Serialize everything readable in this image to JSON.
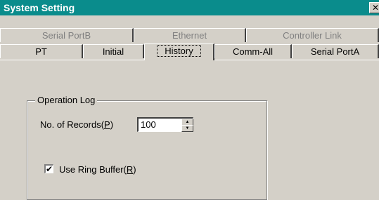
{
  "window": {
    "title": "System Setting",
    "close_glyph": "✕"
  },
  "tabs_back": [
    {
      "label": "Serial PortB"
    },
    {
      "label": "Ethernet"
    },
    {
      "label": "Controller Link"
    }
  ],
  "tabs_front": [
    {
      "label": "PT"
    },
    {
      "label": "Initial"
    },
    {
      "label": "History",
      "active": true
    },
    {
      "label": "Comm-All"
    },
    {
      "label": "Serial PortA"
    }
  ],
  "operation_log": {
    "group_title": "Operation Log",
    "records_label_prefix": "No. of Records(",
    "records_label_key": "P",
    "records_label_suffix": ")",
    "records_value": "100",
    "ring_buffer_checked": true,
    "ring_buffer_mark": "✔",
    "ring_buffer_label_prefix": "Use Ring Buffer(",
    "ring_buffer_label_key": "R",
    "ring_buffer_label_suffix": ")"
  }
}
